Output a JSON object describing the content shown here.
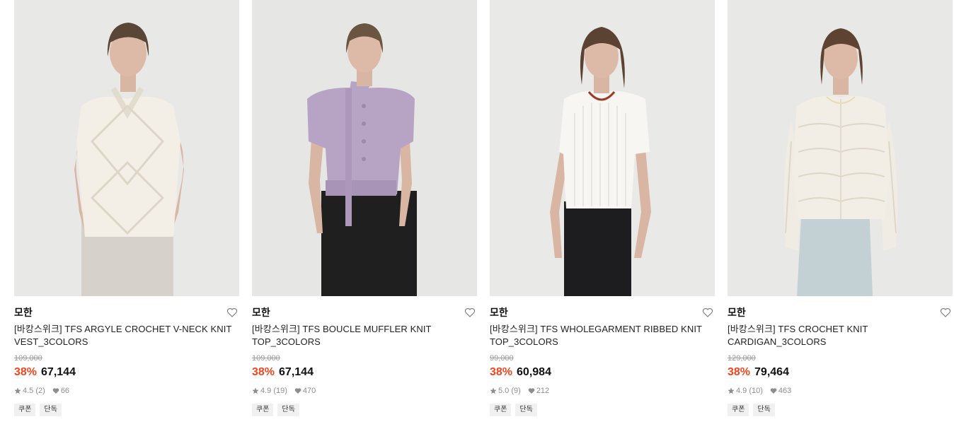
{
  "products": [
    {
      "brand": "모한",
      "name_line1": "[바캉스위크] TFS ARGYLE CROCHET V-NECK KNIT",
      "name_line2": "VEST_3COLORS",
      "original_price": "109,000",
      "discount": "38%",
      "price": "67,144",
      "rating": "4.5",
      "reviews": "(2)",
      "likes": "66",
      "tags": [
        "쿠폰",
        "단독"
      ],
      "image": "white-argyle-crochet-vest-photo"
    },
    {
      "brand": "모한",
      "name_line1": "[바캉스위크] TFS BOUCLE MUFFLER KNIT",
      "name_line2": "TOP_3COLORS",
      "original_price": "109,000",
      "discount": "38%",
      "price": "67,144",
      "rating": "4.9",
      "reviews": "(19)",
      "likes": "470",
      "tags": [
        "쿠폰",
        "단독"
      ],
      "image": "lavender-boucle-muffler-top-photo"
    },
    {
      "brand": "모한",
      "name_line1": "[바캉스위크] TFS WHOLEGARMENT RIBBED KNIT",
      "name_line2": "TOP_3COLORS",
      "original_price": "99,000",
      "discount": "38%",
      "price": "60,984",
      "rating": "5.0",
      "reviews": "(9)",
      "likes": "212",
      "tags": [
        "쿠폰",
        "단독"
      ],
      "image": "white-ribbed-knit-top-photo"
    },
    {
      "brand": "모한",
      "name_line1": "[바캉스위크] TFS CROCHET KNIT",
      "name_line2": "CARDIGAN_3COLORS",
      "original_price": "129,000",
      "discount": "38%",
      "price": "79,464",
      "rating": "4.9",
      "reviews": "(10)",
      "likes": "463",
      "tags": [
        "쿠폰",
        "단독"
      ],
      "image": "cream-crochet-cardigan-photo"
    }
  ],
  "colors": {
    "discount": "#f2441d",
    "photo_bg": "#e7e7e7",
    "muted": "#8d8d8d"
  },
  "icons": {
    "wishlist": "heart-outline-icon",
    "rating": "star-icon",
    "likes": "heart-filled-icon"
  }
}
